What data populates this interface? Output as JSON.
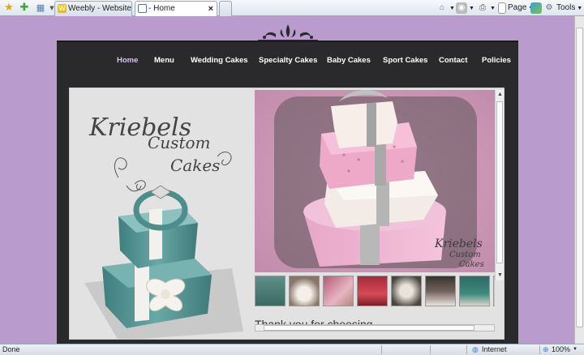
{
  "browser": {
    "tabs": [
      {
        "title": "Weebly - Website Creation ...",
        "active": false
      },
      {
        "title": "- Home",
        "active": true
      }
    ],
    "commands": {
      "page": "Page",
      "tools": "Tools"
    },
    "status": {
      "left": "Done",
      "zone": "Internet",
      "zoom": "100%"
    },
    "icons": [
      "favorites-star-icon",
      "add-favorites-icon",
      "quick-tabs-icon",
      "home-icon",
      "rss-feeds-icon",
      "print-icon",
      "page-icon",
      "research-icon",
      "tools-gear-icon"
    ]
  },
  "site": {
    "nav": [
      {
        "label": "Home",
        "current": true
      },
      {
        "label": "Menu",
        "current": false
      },
      {
        "label": "Wedding Cakes",
        "current": false
      },
      {
        "label": "Specialty Cakes",
        "current": false
      },
      {
        "label": "Baby Cakes",
        "current": false
      },
      {
        "label": "Sport Cakes",
        "current": false
      },
      {
        "label": "Contact",
        "current": false
      },
      {
        "label": "Policies",
        "current": false
      }
    ],
    "logo_lines": [
      "Kriebels",
      "Custom",
      "Cakes"
    ],
    "slide_watermark": [
      "Kriebels",
      "Custom",
      "Cakes"
    ],
    "intro_text": "Thank you for choosing",
    "colors": {
      "page_bg": "#b99bce",
      "band": "#2a2a2d",
      "nav_active": "#d9c2f0",
      "cake_teal": "#5b9b9b",
      "cake_pink": "#e8b4d0"
    }
  }
}
